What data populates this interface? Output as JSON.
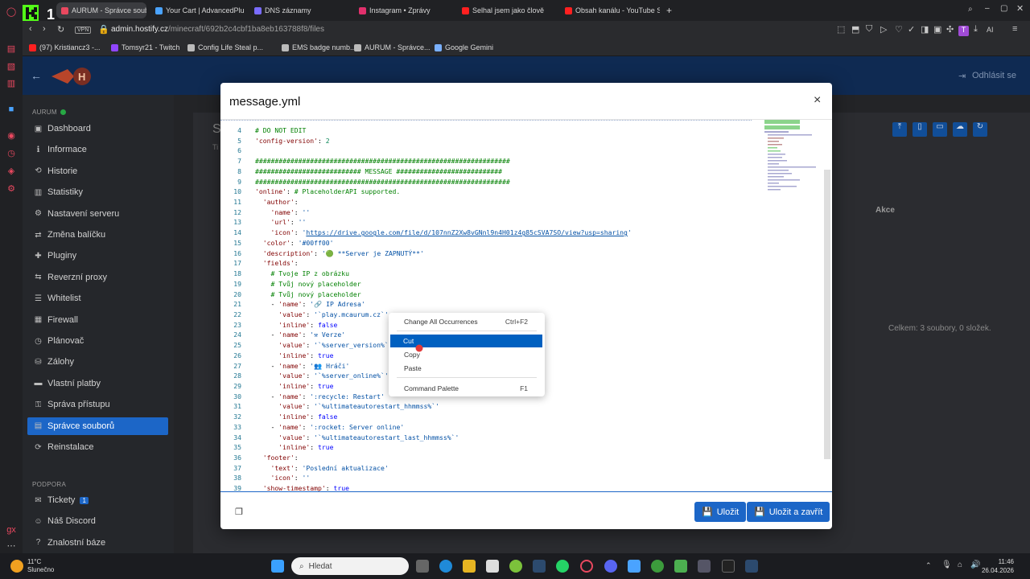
{
  "browser": {
    "tabs": [
      {
        "label": "AURUM - Správce soubor",
        "color": "#e9485f",
        "active": true
      },
      {
        "label": "Your Cart | AdvancedPlug",
        "color": "#4aa3ff",
        "active": false
      },
      {
        "label": "DNS záznamy",
        "color": "#7a6cff",
        "active": false
      },
      {
        "label": "Instagram • Zprávy",
        "color": "#e1306c",
        "active": false
      },
      {
        "label": "Selhal jsem jako člově",
        "color": "#ff2020",
        "active": false
      },
      {
        "label": "Obsah kanálu - YouTube S",
        "color": "#ff2020",
        "active": false
      }
    ],
    "new_tab": "+",
    "url_host": "admin.hostify.cz",
    "url_path": "/minecraft/692b2c4cbf1ba8eb163788f8/files",
    "vpn_label": "VPN",
    "profile_letter": "T",
    "ai_label": "AI",
    "bookmarks": [
      {
        "label": "(97) Kristiancz3 -...",
        "color": "#ff2020"
      },
      {
        "label": "Tomsyr21 - Twitch",
        "color": "#9146ff"
      },
      {
        "label": "Config Life Steal p...",
        "color": "#bbbbbb"
      },
      {
        "label": "EMS badge numb...",
        "color": "#bbbbbb"
      },
      {
        "label": "AURUM - Správce...",
        "color": "#bbbbbb"
      },
      {
        "label": "Google Gemini",
        "color": "#7ab0ff"
      }
    ]
  },
  "app": {
    "logout_label": "Odhlásit se",
    "server_name": "AURUM",
    "sidebar": [
      {
        "label": "Dashboard",
        "icon": "▣"
      },
      {
        "label": "Informace",
        "icon": "ℹ"
      },
      {
        "label": "Historie",
        "icon": "⟲"
      },
      {
        "label": "Statistiky",
        "icon": "▥"
      },
      {
        "label": "Nastavení serveru",
        "icon": "⚙"
      },
      {
        "label": "Změna balíčku",
        "icon": "⇄"
      },
      {
        "label": "Pluginy",
        "icon": "✚"
      },
      {
        "label": "Reverzní proxy",
        "icon": "⇆"
      },
      {
        "label": "Whitelist",
        "icon": "☰"
      },
      {
        "label": "Firewall",
        "icon": "▦"
      },
      {
        "label": "Plánovač",
        "icon": "◷"
      },
      {
        "label": "Zálohy",
        "icon": "⛁"
      },
      {
        "label": "Vlastní platby",
        "icon": "▬"
      },
      {
        "label": "Správa přístupu",
        "icon": "⚿"
      },
      {
        "label": "Správce souborů",
        "icon": "▤",
        "active": true
      },
      {
        "label": "Reinstalace",
        "icon": "⟳"
      }
    ],
    "support_heading": "PODPORA",
    "support": [
      {
        "label": "Tickety",
        "icon": "✉",
        "badge": "1"
      },
      {
        "label": "Náš Discord",
        "icon": "☺"
      },
      {
        "label": "Znalostní báze",
        "icon": "?"
      }
    ],
    "bg_col_header": "Akce",
    "bg_summary": "Celkem: 3 soubory, 0 složek."
  },
  "modal": {
    "title": "message.yml",
    "close": "×",
    "save_label": "Uložit",
    "save_close_label": "Uložit a zavřít"
  },
  "editor": {
    "lines": [
      {
        "n": "4",
        "t": [
          [
            "c-comment",
            "# DO NOT EDIT"
          ]
        ]
      },
      {
        "n": "5",
        "t": [
          [
            "c-key",
            "'config-version'"
          ],
          [
            "c-plain",
            ": "
          ],
          [
            "c-num",
            "2"
          ]
        ]
      },
      {
        "n": "6",
        "t": [
          [
            "c-plain",
            ""
          ]
        ]
      },
      {
        "n": "7",
        "t": [
          [
            "c-comment",
            "#################################################################"
          ]
        ]
      },
      {
        "n": "8",
        "t": [
          [
            "c-comment",
            "########################### MESSAGE ###########################"
          ]
        ]
      },
      {
        "n": "9",
        "t": [
          [
            "c-comment",
            "#################################################################"
          ]
        ]
      },
      {
        "n": "10",
        "t": [
          [
            "c-key",
            "'online'"
          ],
          [
            "c-plain",
            ": "
          ],
          [
            "c-comment",
            "# PlaceholderAPI supported."
          ]
        ]
      },
      {
        "n": "11",
        "t": [
          [
            "c-key",
            "  'author'"
          ],
          [
            "c-plain",
            ":"
          ]
        ]
      },
      {
        "n": "12",
        "t": [
          [
            "c-key",
            "    'name'"
          ],
          [
            "c-plain",
            ": "
          ],
          [
            "c-str",
            "''"
          ]
        ]
      },
      {
        "n": "13",
        "t": [
          [
            "c-key",
            "    'url'"
          ],
          [
            "c-plain",
            ": "
          ],
          [
            "c-str",
            "''"
          ]
        ]
      },
      {
        "n": "14",
        "t": [
          [
            "c-key",
            "    'icon'"
          ],
          [
            "c-plain",
            ": "
          ],
          [
            "c-str",
            "'"
          ],
          [
            "c-link",
            "https://drive.google.com/file/d/107nnZ2Xw8vGNnl9n4H01z4g85cSVA7SO/view?usp=sharing"
          ],
          [
            "c-str",
            "'"
          ]
        ]
      },
      {
        "n": "15",
        "t": [
          [
            "c-key",
            "  'color'"
          ],
          [
            "c-plain",
            ": "
          ],
          [
            "c-str",
            "'#00ff00'"
          ]
        ]
      },
      {
        "n": "16",
        "t": [
          [
            "c-key",
            "  'description'"
          ],
          [
            "c-plain",
            ": "
          ],
          [
            "c-str",
            "'🟢 **Server je ZAPNUTÝ**'"
          ]
        ]
      },
      {
        "n": "17",
        "t": [
          [
            "c-key",
            "  'fields'"
          ],
          [
            "c-plain",
            ":"
          ]
        ]
      },
      {
        "n": "18",
        "t": [
          [
            "c-comment",
            "    # Tvoje IP z obrázku"
          ]
        ]
      },
      {
        "n": "19",
        "t": [
          [
            "c-comment",
            "    # Tvůj nový placeholder"
          ]
        ]
      },
      {
        "n": "20",
        "t": [
          [
            "c-comment",
            "    # Tvůj nový placeholder"
          ]
        ]
      },
      {
        "n": "21",
        "t": [
          [
            "c-plain",
            "    - "
          ],
          [
            "c-key",
            "'name'"
          ],
          [
            "c-plain",
            ": "
          ],
          [
            "c-str",
            "'🔗 IP Adresa'"
          ]
        ]
      },
      {
        "n": "22",
        "t": [
          [
            "c-key",
            "      'value'"
          ],
          [
            "c-plain",
            ": "
          ],
          [
            "c-str",
            "'`play.mcaurum.cz`'"
          ]
        ]
      },
      {
        "n": "23",
        "t": [
          [
            "c-key",
            "      'inline'"
          ],
          [
            "c-plain",
            ": "
          ],
          [
            "c-bool",
            "false"
          ]
        ]
      },
      {
        "n": "24",
        "t": [
          [
            "c-plain",
            "    - "
          ],
          [
            "c-key",
            "'name'"
          ],
          [
            "c-plain",
            ": "
          ],
          [
            "c-str",
            "'⚒ Verze'"
          ]
        ]
      },
      {
        "n": "25",
        "t": [
          [
            "c-key",
            "      'value'"
          ],
          [
            "c-plain",
            ": "
          ],
          [
            "c-str",
            "'`%server_version%`'"
          ]
        ]
      },
      {
        "n": "26",
        "t": [
          [
            "c-key",
            "      'inline'"
          ],
          [
            "c-plain",
            ": "
          ],
          [
            "c-bool",
            "true"
          ]
        ]
      },
      {
        "n": "27",
        "t": [
          [
            "c-plain",
            "    - "
          ],
          [
            "c-key",
            "'name'"
          ],
          [
            "c-plain",
            ": "
          ],
          [
            "c-str",
            "'👥 Hráči'"
          ]
        ]
      },
      {
        "n": "28",
        "t": [
          [
            "c-key",
            "      'value'"
          ],
          [
            "c-plain",
            ": "
          ],
          [
            "c-str",
            "'`%server_online%`'"
          ]
        ]
      },
      {
        "n": "29",
        "t": [
          [
            "c-key",
            "      'inline'"
          ],
          [
            "c-plain",
            ": "
          ],
          [
            "c-bool",
            "true"
          ]
        ]
      },
      {
        "n": "30",
        "t": [
          [
            "c-plain",
            "    - "
          ],
          [
            "c-key",
            "'name'"
          ],
          [
            "c-plain",
            ": "
          ],
          [
            "c-str",
            "':recycle: Restart'"
          ]
        ]
      },
      {
        "n": "31",
        "t": [
          [
            "c-key",
            "      'value'"
          ],
          [
            "c-plain",
            ": "
          ],
          [
            "c-str",
            "'`%ultimateautorestart_hhmmss%`'"
          ]
        ]
      },
      {
        "n": "32",
        "t": [
          [
            "c-key",
            "      'inline'"
          ],
          [
            "c-plain",
            ": "
          ],
          [
            "c-bool",
            "false"
          ]
        ]
      },
      {
        "n": "33",
        "t": [
          [
            "c-plain",
            "    - "
          ],
          [
            "c-key",
            "'name'"
          ],
          [
            "c-plain",
            ": "
          ],
          [
            "c-str",
            "':rocket: Server online'"
          ]
        ]
      },
      {
        "n": "34",
        "t": [
          [
            "c-key",
            "      'value'"
          ],
          [
            "c-plain",
            ": "
          ],
          [
            "c-str",
            "'`%ultimateautorestart_last_hhmmss%`'"
          ]
        ]
      },
      {
        "n": "35",
        "t": [
          [
            "c-key",
            "      'inline'"
          ],
          [
            "c-plain",
            ": "
          ],
          [
            "c-bool",
            "true"
          ]
        ]
      },
      {
        "n": "36",
        "t": [
          [
            "c-key",
            "  'footer'"
          ],
          [
            "c-plain",
            ":"
          ]
        ]
      },
      {
        "n": "37",
        "t": [
          [
            "c-key",
            "    'text'"
          ],
          [
            "c-plain",
            ": "
          ],
          [
            "c-str",
            "'Poslední aktualizace'"
          ]
        ]
      },
      {
        "n": "38",
        "t": [
          [
            "c-key",
            "    'icon'"
          ],
          [
            "c-plain",
            ": "
          ],
          [
            "c-str",
            "''"
          ]
        ]
      },
      {
        "n": "39",
        "t": [
          [
            "c-key",
            "  'show-timestamp'"
          ],
          [
            "c-plain",
            ": "
          ],
          [
            "c-bool",
            "true"
          ]
        ]
      }
    ]
  },
  "context_menu": [
    {
      "label": "Change All Occurrences",
      "shortcut": "Ctrl+F2"
    },
    {
      "label": "Cut",
      "shortcut": "",
      "selected": true
    },
    {
      "label": "Copy",
      "shortcut": ""
    },
    {
      "label": "Paste",
      "shortcut": ""
    },
    {
      "label": "Command Palette",
      "shortcut": "F1"
    }
  ],
  "taskbar": {
    "temp": "11°C",
    "weather": "Slunečno",
    "search_placeholder": "Hledat",
    "time": "11:46",
    "date": "26.04.2026"
  },
  "colors": {
    "accent": "#1c66c7",
    "menu_selection": "#0060c0"
  }
}
